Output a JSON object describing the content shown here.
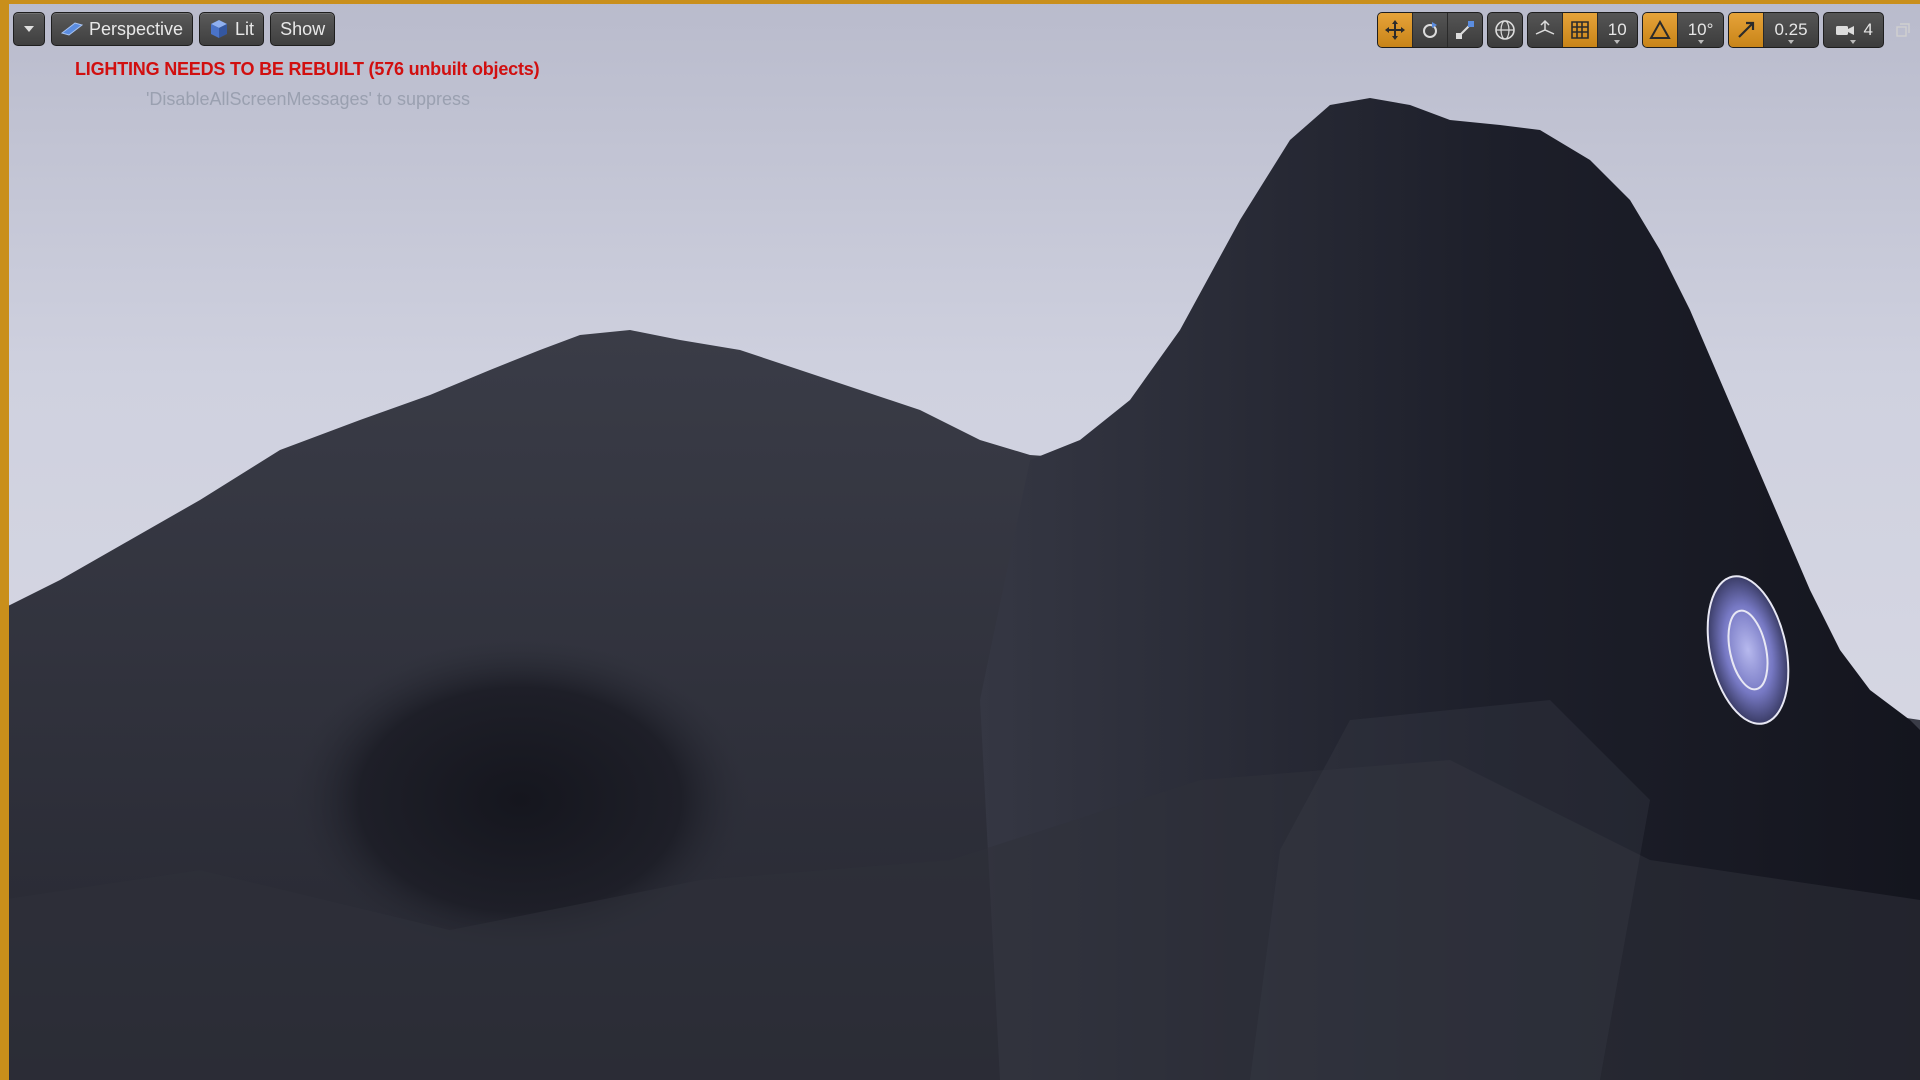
{
  "toolbar": {
    "view_mode": "Perspective",
    "lighting_mode": "Lit",
    "show_label": "Show",
    "grid_snap_value": "10",
    "rotation_snap_value": "10°",
    "scale_snap_value": "0.25",
    "camera_speed_value": "4"
  },
  "messages": {
    "lighting_warning": "LIGHTING NEEDS TO BE REBUILT (576 unbuilt objects)",
    "suppress_hint": "'DisableAllScreenMessages' to suppress"
  },
  "icons": {
    "view_menu": "chevron-down-icon",
    "perspective": "perspective-icon",
    "lit": "lit-cube-icon",
    "translate": "translate-icon",
    "rotate": "rotate-icon",
    "scale": "scale-icon",
    "world_local": "globe-icon",
    "surface_snap": "surface-snap-icon",
    "grid": "grid-icon",
    "rotation_snap": "angle-icon",
    "scale_snap": "scale-snap-icon",
    "camera_speed": "camera-icon",
    "maximize": "maximize-icon"
  },
  "colors": {
    "active_accent": "#d8962a",
    "viewport_border": "#c98f1b",
    "warning_text": "#d10f0f",
    "sky": "#cfd1df",
    "terrain": "#2a2c36"
  }
}
